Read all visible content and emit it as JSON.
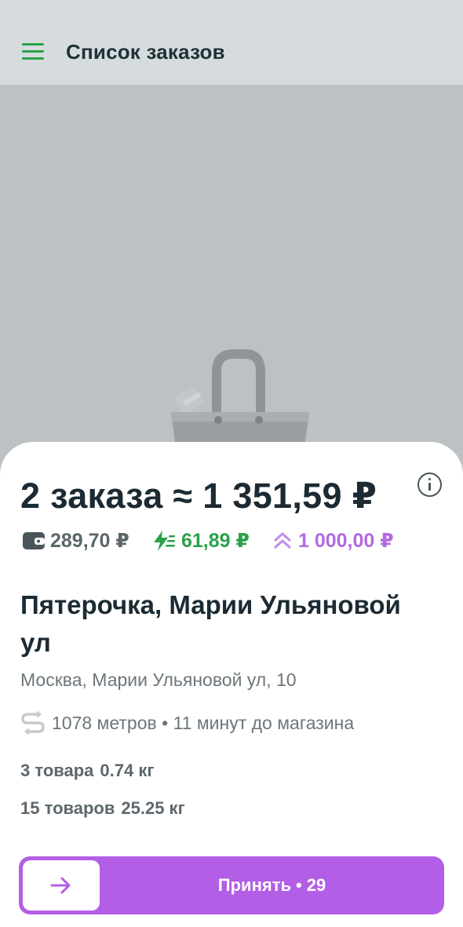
{
  "app_bar": {
    "title": "Список заказов",
    "menu_icon": "hamburger-menu-icon"
  },
  "illustration": {
    "icon": "shopping-basket-icon"
  },
  "order_summary": {
    "total": "2 заказа ≈ 1 351,59 ₽",
    "info_icon": "info-icon",
    "base_pay": {
      "icon": "wallet-icon",
      "amount": "289,70 ₽"
    },
    "bonus_pay": {
      "icon": "lightning-icon",
      "amount": "61,89 ₽"
    },
    "extra_pay": {
      "icon": "double-chevron-up-icon",
      "amount": "1 000,00 ₽"
    }
  },
  "store": {
    "name": "Пятерочка, Марии Ульяновой ул",
    "address": "Москва, Марии Ульяновой ул, 10"
  },
  "route": {
    "icon": "route-icon",
    "text": "1078 метров • 11 минут до магазина"
  },
  "orders": [
    {
      "items": "3 товара",
      "weight": "0.74 кг"
    },
    {
      "items": "15 товаров",
      "weight": "25.25 кг"
    }
  ],
  "accept_button": {
    "label": "Принять",
    "separator": "•",
    "counter": "29",
    "arrow_icon": "arrow-right-icon"
  },
  "colors": {
    "accent_green": "#2aa14a",
    "accent_purple": "#b35ee6",
    "text_dark": "#1b2a33",
    "text_muted": "#6c767b",
    "map_background": "#bcc2c4"
  }
}
